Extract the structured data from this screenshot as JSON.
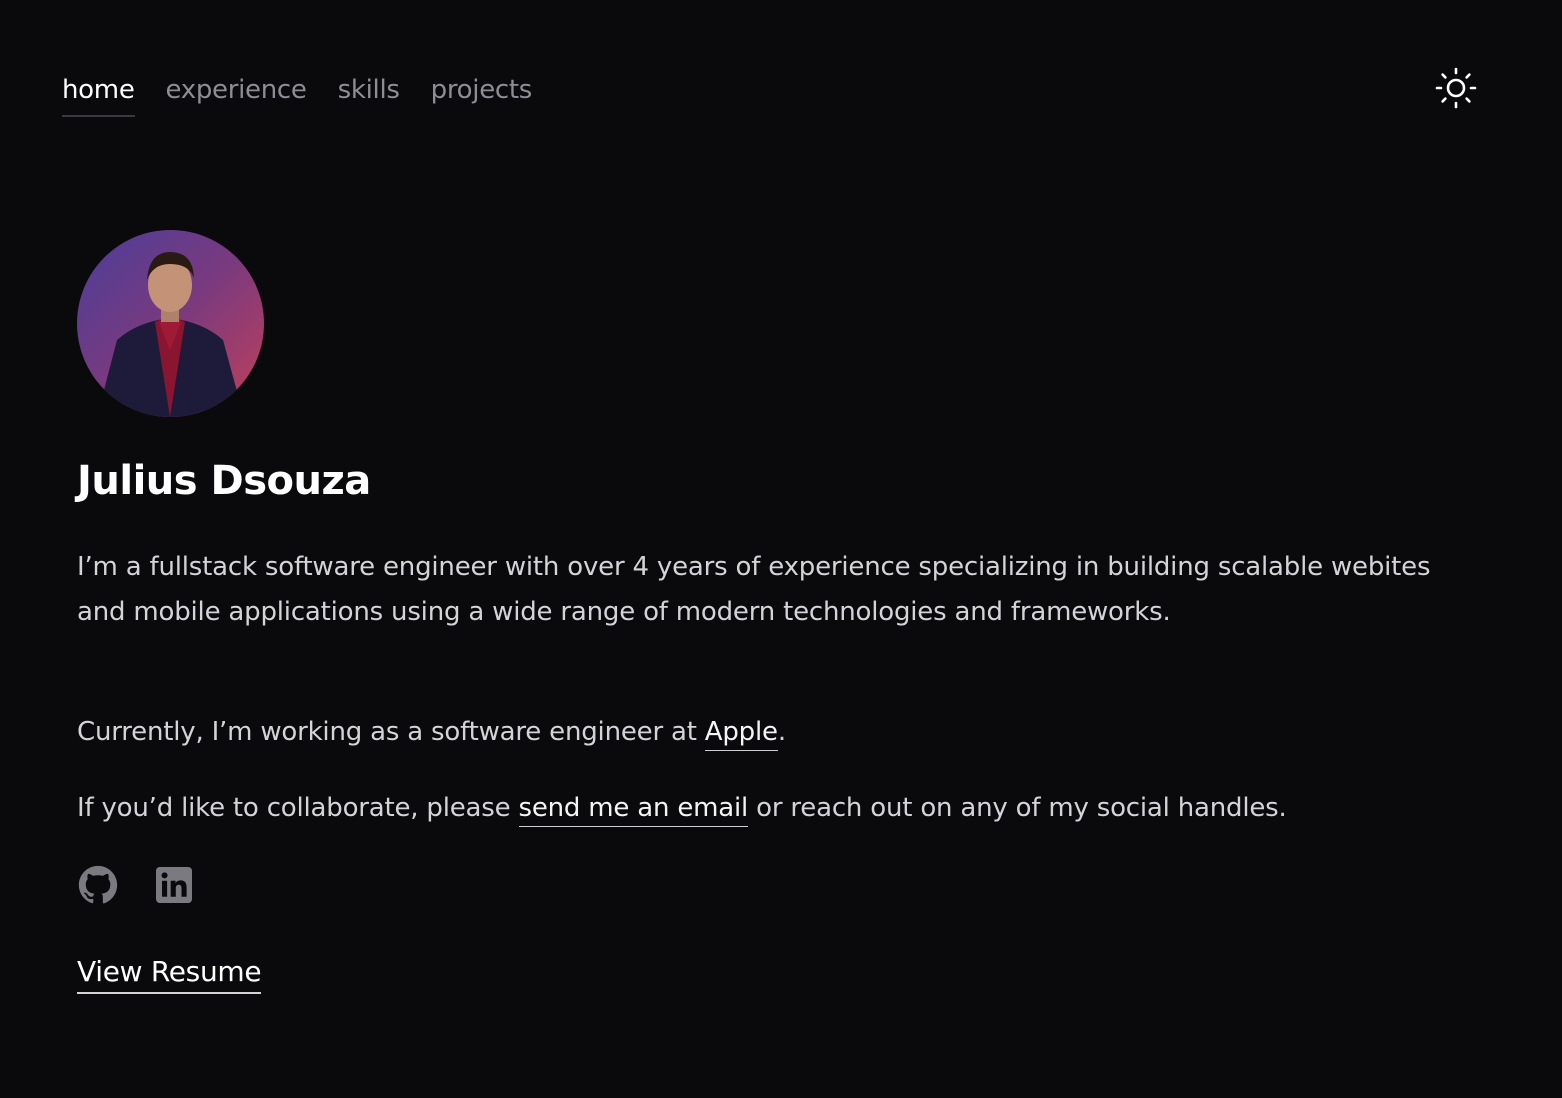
{
  "nav": {
    "items": [
      {
        "label": "home",
        "active": true
      },
      {
        "label": "experience",
        "active": false
      },
      {
        "label": "skills",
        "active": false
      },
      {
        "label": "projects",
        "active": false
      }
    ],
    "theme_toggle_icon": "sun-icon"
  },
  "profile": {
    "name": "Julius Dsouza",
    "avatar_icon": "profile-photo"
  },
  "intro": {
    "bio": "I’m a fullstack software engineer with over 4 years of experience specializing in building scalable webites and mobile applications using a wide range of modern technologies and frameworks.",
    "current_prefix": "Currently, I’m working as a software engineer at ",
    "current_company": "Apple",
    "current_suffix": ".",
    "collab_prefix": "If you’d like to collaborate, please ",
    "collab_link": "send me an email",
    "collab_suffix": " or reach out on any of my social handles."
  },
  "socials": [
    {
      "icon": "github-icon"
    },
    {
      "icon": "linkedin-icon"
    }
  ],
  "resume_label": "View Resume",
  "colors": {
    "background": "#0a0a0c",
    "text": "#e4e4e7",
    "muted": "#8d8d93",
    "icon": "#7a7a80"
  }
}
